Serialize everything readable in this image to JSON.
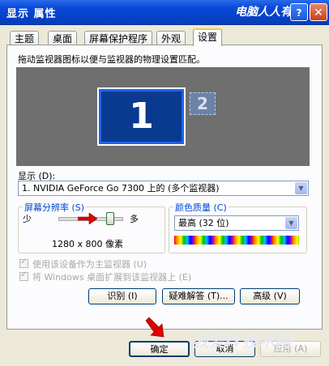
{
  "window": {
    "title": "显示 属性",
    "watermark": "电脑人人有",
    "help": "?",
    "close": "✕"
  },
  "tabs": [
    "主题",
    "桌面",
    "屏幕保护程序",
    "外观",
    "设置"
  ],
  "instruction": "拖动监视器图标以便与监视器的物理设置匹配。",
  "monitors": {
    "primary": "1",
    "secondary": "2"
  },
  "display_label": "显示 (D):",
  "display_value": "1. NVIDIA GeForce Go 7300 上的 (多个监视器)",
  "resolution": {
    "group": "屏幕分辨率 (S)",
    "less": "少",
    "more": "多",
    "value": "1280 x 800 像素",
    "level": 1.0
  },
  "color_quality": {
    "group": "颜色质量 (C)",
    "value": "最高 (32 位)"
  },
  "checkboxes": [
    "使用该设备作为主监视器 (U)",
    "将 Windows 桌面扩展到该监视器上 (E)"
  ],
  "buttons": {
    "identify": "识别 (I)",
    "troubleshoot": "疑难解答 (T)...",
    "advanced": "高级 (V)",
    "ok": "确定",
    "cancel": "取消",
    "apply": "应用 (A)"
  },
  "bottom_watermark": "我爱IT技术网",
  "colors": {
    "titlebar": "#0a4ad8",
    "active_tab_accent": "#ffc83c",
    "primary_monitor": "#0a3a90",
    "group_title": "#0046d5",
    "red_arrow": "#e00000"
  }
}
